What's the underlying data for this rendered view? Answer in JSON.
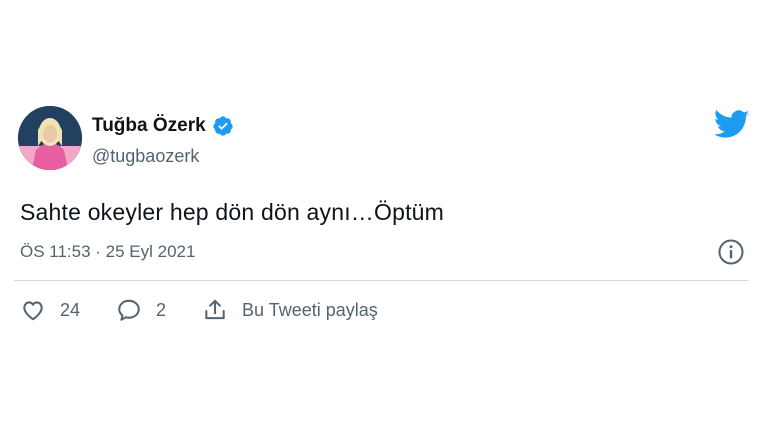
{
  "author": {
    "display_name": "Tuğba Özerk",
    "handle": "@tugbaozerk",
    "verified": true,
    "avatar_icon": "profile-photo"
  },
  "tweet": {
    "text": "Sahte okeyler hep dön dön aynı…Öptüm",
    "timestamp": "ÖS 11:53 · 25 Eyl 2021"
  },
  "actions": {
    "likes": "24",
    "replies": "2",
    "share_label": "Bu Tweeti paylaş"
  },
  "colors": {
    "brand": "#1d9bf0",
    "muted": "#536471",
    "divider": "#cfd9de"
  }
}
